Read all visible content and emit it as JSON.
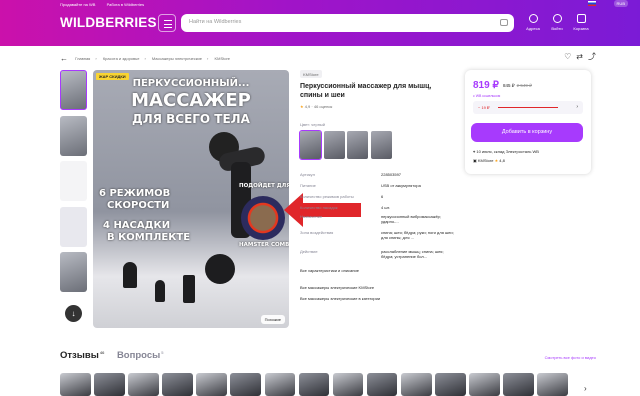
{
  "topbar": {
    "seller_link": "Продавайте на WB",
    "jobs_link": "Работа в Wildberries",
    "currency": "RUB",
    "brand": "WILDBERRIES",
    "search_placeholder": "Найти на Wildberries",
    "nav": [
      "Адреса",
      "Войти",
      "Корзина"
    ]
  },
  "breadcrumbs": [
    "Главная",
    "Красота и здоровье",
    "Массажеры электрические",
    "KMStore"
  ],
  "gallery": {
    "badge": "ЖАР СКИДКИ",
    "title1": "ПЕРКУССИОННЫЙ...",
    "title2": "МАССАЖЕР",
    "title3": "ДЛЯ ВСЕГО ТЕЛА",
    "feat1a": "6 РЕЖИМОВ",
    "feat1b": "СКОРОСТИ",
    "feat2a": "4 НАСАДКИ",
    "feat2b": "В КОМПЛЕКТЕ",
    "fits1": "ПОДОЙДЕТ ДЛЯ",
    "fits2": "HAMSTER COMBAT",
    "similar": "Похожие"
  },
  "product": {
    "shop": "KMStore",
    "title": "Перкуссионный массажер для мышц, спины и шеи",
    "rating": "4,9",
    "reviews_count": "46 оценок",
    "color_label": "Цвет: черный"
  },
  "specs": [
    {
      "k": "Артикул",
      "v": "228503597"
    },
    {
      "k": "Питание",
      "v": "USB от аккумулятора"
    },
    {
      "k": "Количество режимов работы",
      "v": "6"
    },
    {
      "k": "Количество насадок",
      "v": "4 шт."
    },
    {
      "k": "Назначение",
      "v": "перкуссионный вибромассажёр; ударно-..."
    },
    {
      "k": "Зона воздействия",
      "v": "спина; шея; бёдра; руки; ноги для шеи; для спины; для ..."
    },
    {
      "k": "Действие",
      "v": "расслабление мышц; спина; шея; бёдра; устранение бол..."
    }
  ],
  "links": {
    "all_specs": "Все характеристики и описание",
    "store_more": "Все массажеры электрические KMStore",
    "cat_more": "Все массажеры электрические в категории"
  },
  "card": {
    "price": "819 ₽",
    "old": "845 ₽",
    "crossed": "2 549 ₽",
    "wallet": "с WB кошельком",
    "insurance": "− 19 ₽",
    "buy": "Добавить в корзину",
    "delivery": "10 июля, склад Электросталь WB",
    "seller": "KMStore",
    "seller_rating": "4,8"
  },
  "section": {
    "reviews": "Отзывы",
    "reviews_n": "46",
    "questions": "Вопросы",
    "questions_n": "5",
    "view_all": "Смотреть все фото и видео"
  }
}
